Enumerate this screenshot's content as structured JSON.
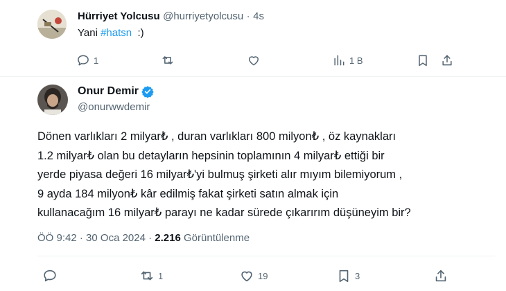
{
  "reply": {
    "display_name": "Hürriyet Yolcusu",
    "handle": "@hurriyetyolcusu",
    "separator": "·",
    "time": "4s",
    "text_prefix": "Yani ",
    "hashtag": "#hatsn",
    "text_suffix": "  :)",
    "actions": {
      "reply_count": "1",
      "retweet_count": "",
      "like_count": "",
      "views_count": "1 B"
    }
  },
  "main": {
    "display_name": "Onur Demir",
    "handle": "@onurwwdemir",
    "body": "Dönen varlıkları 2 milyar₺ , duran varlıkları 800 milyon₺ , öz kaynakları\n1.2 milyar₺ olan bu detayların hepsinin toplamının 4 milyar₺ ettiği bir\nyerde piyasa değeri 16 milyar₺'yi bulmuş şirketi alır mıyım bilemiyorum ,\n 9 ayda 184 milyon₺ kâr edilmiş fakat şirketi satın almak için\nkullanacağım 16 milyar₺ parayı ne kadar sürede çıkarırım düşüneyim bir?",
    "time": "ÖÖ 9:42",
    "separator1": "·",
    "date": "30 Oca 2024",
    "separator2": "·",
    "views": "2.216",
    "views_label": "Görüntülenme",
    "actions": {
      "reply_count": "",
      "retweet_count": "1",
      "like_count": "19",
      "bookmark_count": "3"
    }
  },
  "colors": {
    "accent": "#1d9bf0",
    "muted": "#536471",
    "text": "#0f1419",
    "verified": "#1d9bf0"
  }
}
